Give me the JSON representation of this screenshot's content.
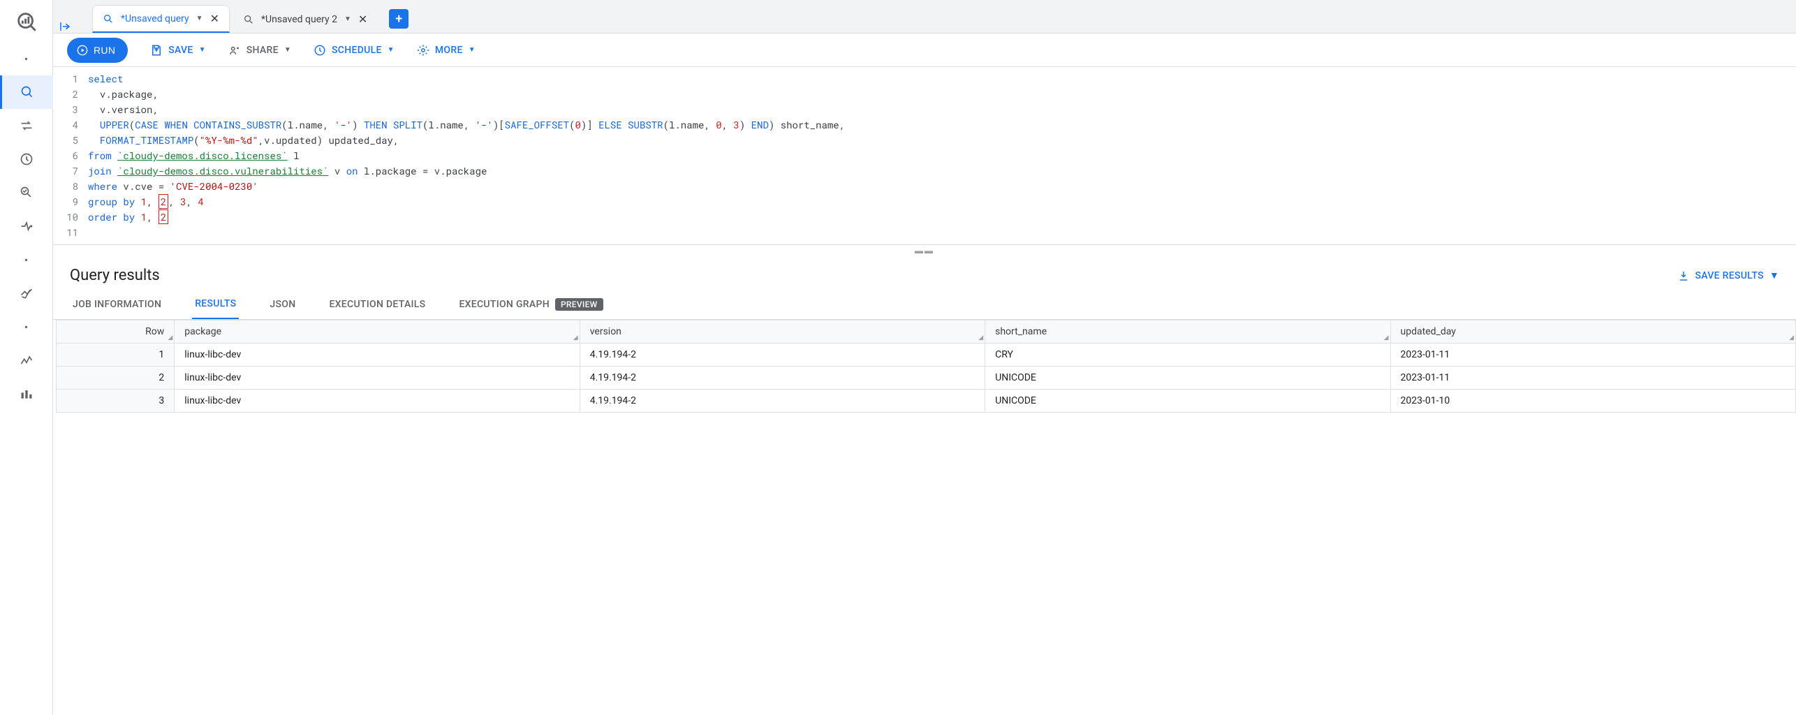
{
  "tabs": [
    {
      "label": "*Unsaved query",
      "active": true
    },
    {
      "label": "*Unsaved query 2",
      "active": false
    }
  ],
  "toolbar": {
    "run": "RUN",
    "save": "SAVE",
    "share": "SHARE",
    "schedule": "SCHEDULE",
    "more": "MORE"
  },
  "editor_lines": [
    "select",
    "  v.package,",
    "  v.version,",
    "  UPPER(CASE WHEN CONTAINS_SUBSTR(l.name, '-') THEN SPLIT(l.name, '-')[SAFE_OFFSET(0)] ELSE SUBSTR(l.name, 0, 3) END) short_name,",
    "  FORMAT_TIMESTAMP(\"%Y-%m-%d\",v.updated) updated_day,",
    "from `cloudy-demos.disco.licenses` l",
    "join `cloudy-demos.disco.vulnerabilities` v on l.package = v.package",
    "where v.cve = 'CVE-2004-0230'",
    "group by 1, 2, 3, 4",
    "order by 1, 2",
    ""
  ],
  "results": {
    "title": "Query results",
    "save_label": "SAVE RESULTS",
    "tabs": {
      "job": "JOB INFORMATION",
      "results": "RESULTS",
      "json": "JSON",
      "exec": "EXECUTION DETAILS",
      "graph": "EXECUTION GRAPH",
      "preview_badge": "PREVIEW"
    },
    "columns": [
      "Row",
      "package",
      "version",
      "short_name",
      "updated_day"
    ],
    "rows": [
      {
        "n": "1",
        "package": "linux-libc-dev",
        "version": "4.19.194-2",
        "short_name": "CRY",
        "updated_day": "2023-01-11"
      },
      {
        "n": "2",
        "package": "linux-libc-dev",
        "version": "4.19.194-2",
        "short_name": "UNICODE",
        "updated_day": "2023-01-11"
      },
      {
        "n": "3",
        "package": "linux-libc-dev",
        "version": "4.19.194-2",
        "short_name": "UNICODE",
        "updated_day": "2023-01-10"
      }
    ]
  }
}
